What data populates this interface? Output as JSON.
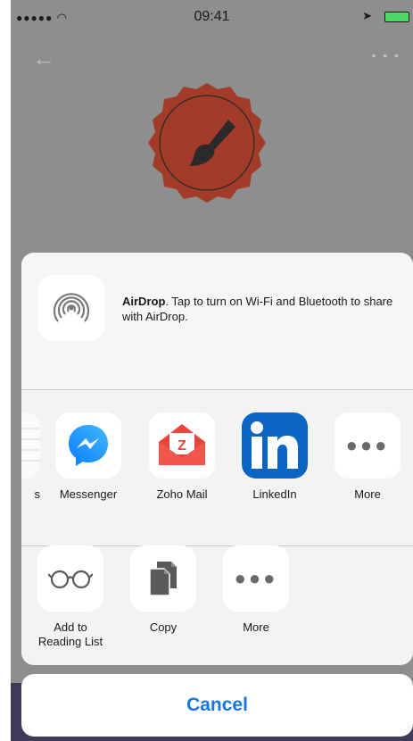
{
  "status_bar": {
    "signal": "●●●●● ",
    "time": "09:41",
    "location_icon": "location-arrow-icon",
    "battery_color": "#4cd964"
  },
  "background_app": {
    "back_icon": "back-arrow-icon",
    "more_icon": "more-dots-icon",
    "badge_color": "#a23b27",
    "badge_icon": "paintbrush-icon"
  },
  "share_sheet": {
    "airdrop": {
      "title": "AirDrop",
      "description": ". Tap to turn on Wi-Fi and Bluetooth to share with AirDrop."
    },
    "apps": [
      {
        "label": "s",
        "icon": "partial-app-icon"
      },
      {
        "label": "Messenger",
        "icon": "messenger-icon",
        "color": "#1a8cff"
      },
      {
        "label": "Zoho Mail",
        "icon": "zoho-mail-icon",
        "color": "#e8463c"
      },
      {
        "label": "LinkedIn",
        "icon": "linkedin-icon",
        "color": "#0a66c2"
      },
      {
        "label": "More",
        "icon": "more-icon"
      }
    ],
    "actions": [
      {
        "label": "Add to Reading List",
        "icon": "glasses-icon"
      },
      {
        "label": "Copy",
        "icon": "copy-icon"
      },
      {
        "label": "More",
        "icon": "more-icon"
      }
    ]
  },
  "cancel": {
    "label": "Cancel",
    "color": "#1676e3"
  }
}
